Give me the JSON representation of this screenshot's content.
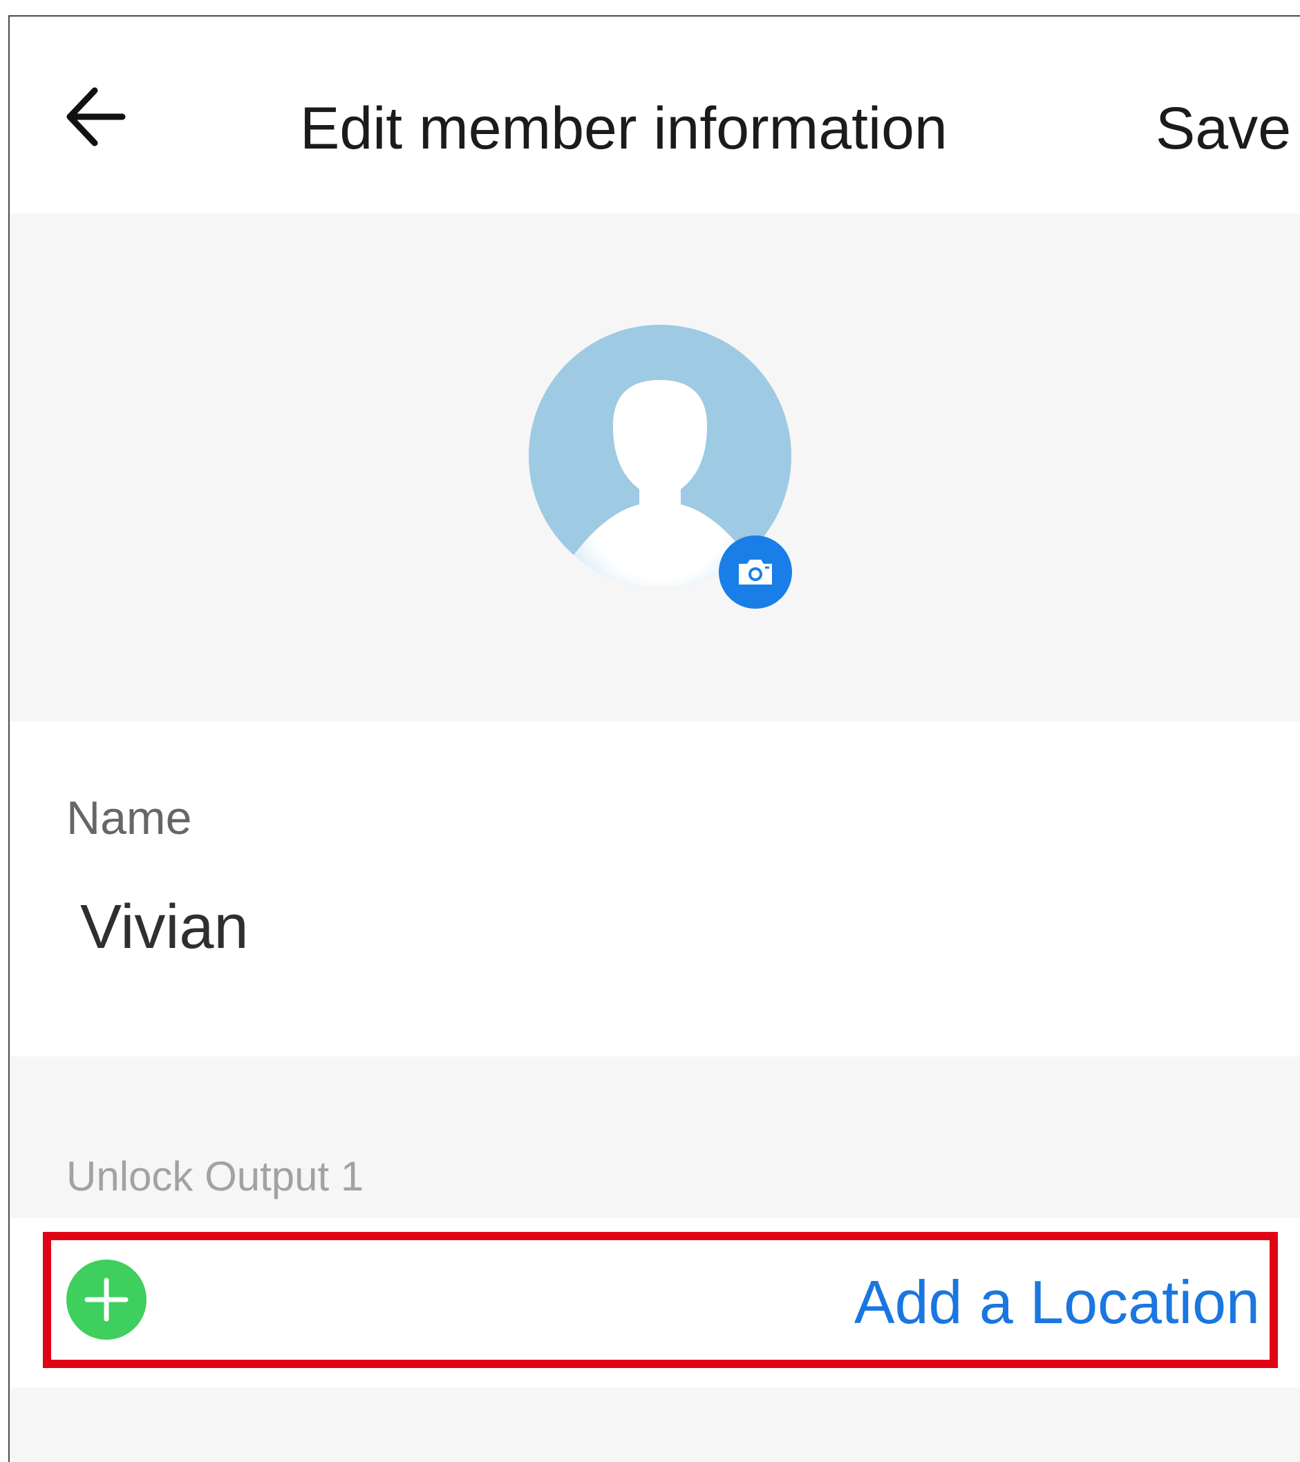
{
  "header": {
    "back_icon": "arrow-left-icon",
    "title": "Edit member information",
    "save_label": "Save"
  },
  "avatar": {
    "icon": "person-silhouette-icon",
    "camera_icon": "camera-icon"
  },
  "name_field": {
    "label": "Name",
    "value": "Vivian"
  },
  "unlock_section": {
    "label": "Unlock Output 1"
  },
  "add_location": {
    "icon": "plus-circle-icon",
    "label": "Add a Location"
  },
  "colors": {
    "accent_blue": "#1a76e0",
    "add_green": "#3ecf5e",
    "highlight_red": "#e00514",
    "avatar_bg": "#9ecae3",
    "section_bg": "#f6f6f6"
  }
}
